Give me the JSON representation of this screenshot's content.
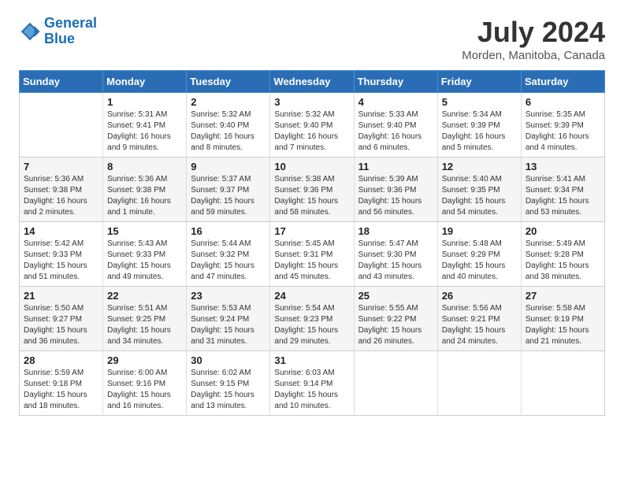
{
  "logo": {
    "line1": "General",
    "line2": "Blue"
  },
  "title": "July 2024",
  "location": "Morden, Manitoba, Canada",
  "days_header": [
    "Sunday",
    "Monday",
    "Tuesday",
    "Wednesday",
    "Thursday",
    "Friday",
    "Saturday"
  ],
  "weeks": [
    [
      {
        "num": "",
        "sunrise": "",
        "sunset": "",
        "daylight": ""
      },
      {
        "num": "1",
        "sunrise": "5:31 AM",
        "sunset": "9:41 PM",
        "daylight": "16 hours and 9 minutes."
      },
      {
        "num": "2",
        "sunrise": "5:32 AM",
        "sunset": "9:40 PM",
        "daylight": "16 hours and 8 minutes."
      },
      {
        "num": "3",
        "sunrise": "5:32 AM",
        "sunset": "9:40 PM",
        "daylight": "16 hours and 7 minutes."
      },
      {
        "num": "4",
        "sunrise": "5:33 AM",
        "sunset": "9:40 PM",
        "daylight": "16 hours and 6 minutes."
      },
      {
        "num": "5",
        "sunrise": "5:34 AM",
        "sunset": "9:39 PM",
        "daylight": "16 hours and 5 minutes."
      },
      {
        "num": "6",
        "sunrise": "5:35 AM",
        "sunset": "9:39 PM",
        "daylight": "16 hours and 4 minutes."
      }
    ],
    [
      {
        "num": "7",
        "sunrise": "5:36 AM",
        "sunset": "9:38 PM",
        "daylight": "16 hours and 2 minutes."
      },
      {
        "num": "8",
        "sunrise": "5:36 AM",
        "sunset": "9:38 PM",
        "daylight": "16 hours and 1 minute."
      },
      {
        "num": "9",
        "sunrise": "5:37 AM",
        "sunset": "9:37 PM",
        "daylight": "15 hours and 59 minutes."
      },
      {
        "num": "10",
        "sunrise": "5:38 AM",
        "sunset": "9:36 PM",
        "daylight": "15 hours and 58 minutes."
      },
      {
        "num": "11",
        "sunrise": "5:39 AM",
        "sunset": "9:36 PM",
        "daylight": "15 hours and 56 minutes."
      },
      {
        "num": "12",
        "sunrise": "5:40 AM",
        "sunset": "9:35 PM",
        "daylight": "15 hours and 54 minutes."
      },
      {
        "num": "13",
        "sunrise": "5:41 AM",
        "sunset": "9:34 PM",
        "daylight": "15 hours and 53 minutes."
      }
    ],
    [
      {
        "num": "14",
        "sunrise": "5:42 AM",
        "sunset": "9:33 PM",
        "daylight": "15 hours and 51 minutes."
      },
      {
        "num": "15",
        "sunrise": "5:43 AM",
        "sunset": "9:33 PM",
        "daylight": "15 hours and 49 minutes."
      },
      {
        "num": "16",
        "sunrise": "5:44 AM",
        "sunset": "9:32 PM",
        "daylight": "15 hours and 47 minutes."
      },
      {
        "num": "17",
        "sunrise": "5:45 AM",
        "sunset": "9:31 PM",
        "daylight": "15 hours and 45 minutes."
      },
      {
        "num": "18",
        "sunrise": "5:47 AM",
        "sunset": "9:30 PM",
        "daylight": "15 hours and 43 minutes."
      },
      {
        "num": "19",
        "sunrise": "5:48 AM",
        "sunset": "9:29 PM",
        "daylight": "15 hours and 40 minutes."
      },
      {
        "num": "20",
        "sunrise": "5:49 AM",
        "sunset": "9:28 PM",
        "daylight": "15 hours and 38 minutes."
      }
    ],
    [
      {
        "num": "21",
        "sunrise": "5:50 AM",
        "sunset": "9:27 PM",
        "daylight": "15 hours and 36 minutes."
      },
      {
        "num": "22",
        "sunrise": "5:51 AM",
        "sunset": "9:25 PM",
        "daylight": "15 hours and 34 minutes."
      },
      {
        "num": "23",
        "sunrise": "5:53 AM",
        "sunset": "9:24 PM",
        "daylight": "15 hours and 31 minutes."
      },
      {
        "num": "24",
        "sunrise": "5:54 AM",
        "sunset": "9:23 PM",
        "daylight": "15 hours and 29 minutes."
      },
      {
        "num": "25",
        "sunrise": "5:55 AM",
        "sunset": "9:22 PM",
        "daylight": "15 hours and 26 minutes."
      },
      {
        "num": "26",
        "sunrise": "5:56 AM",
        "sunset": "9:21 PM",
        "daylight": "15 hours and 24 minutes."
      },
      {
        "num": "27",
        "sunrise": "5:58 AM",
        "sunset": "9:19 PM",
        "daylight": "15 hours and 21 minutes."
      }
    ],
    [
      {
        "num": "28",
        "sunrise": "5:59 AM",
        "sunset": "9:18 PM",
        "daylight": "15 hours and 18 minutes."
      },
      {
        "num": "29",
        "sunrise": "6:00 AM",
        "sunset": "9:16 PM",
        "daylight": "15 hours and 16 minutes."
      },
      {
        "num": "30",
        "sunrise": "6:02 AM",
        "sunset": "9:15 PM",
        "daylight": "15 hours and 13 minutes."
      },
      {
        "num": "31",
        "sunrise": "6:03 AM",
        "sunset": "9:14 PM",
        "daylight": "15 hours and 10 minutes."
      },
      {
        "num": "",
        "sunrise": "",
        "sunset": "",
        "daylight": ""
      },
      {
        "num": "",
        "sunrise": "",
        "sunset": "",
        "daylight": ""
      },
      {
        "num": "",
        "sunrise": "",
        "sunset": "",
        "daylight": ""
      }
    ]
  ]
}
